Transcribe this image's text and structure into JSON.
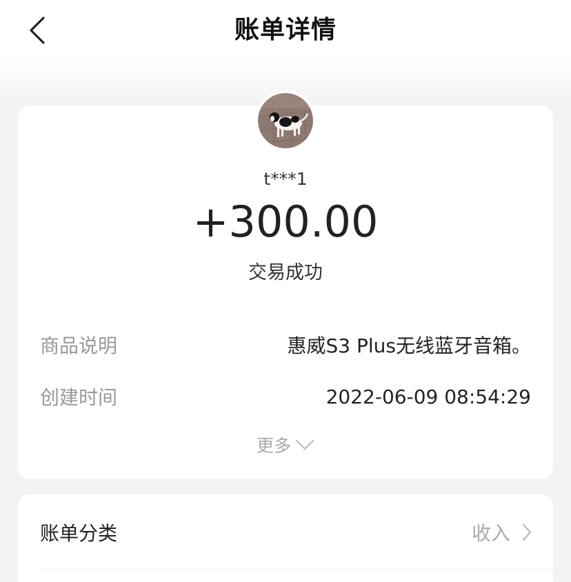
{
  "header": {
    "title": "账单详情",
    "back_icon": "chevron-left-icon"
  },
  "transaction": {
    "payer": "t***1",
    "amount": "+300.00",
    "status": "交易成功"
  },
  "details": {
    "goods_label": "商品说明",
    "goods_value": "惠威S3 Plus无线蓝牙音箱。",
    "time_label": "创建时间",
    "time_value": "2022-06-09 08:54:29",
    "more_label": "更多",
    "more_icon": "chevron-down-icon"
  },
  "category": {
    "label": "账单分类",
    "value": "收入",
    "arrow_icon": "chevron-right-icon"
  },
  "colors": {
    "background": "#f3f3f3",
    "card": "#ffffff",
    "text_primary": "#222222",
    "text_secondary": "#999999"
  }
}
